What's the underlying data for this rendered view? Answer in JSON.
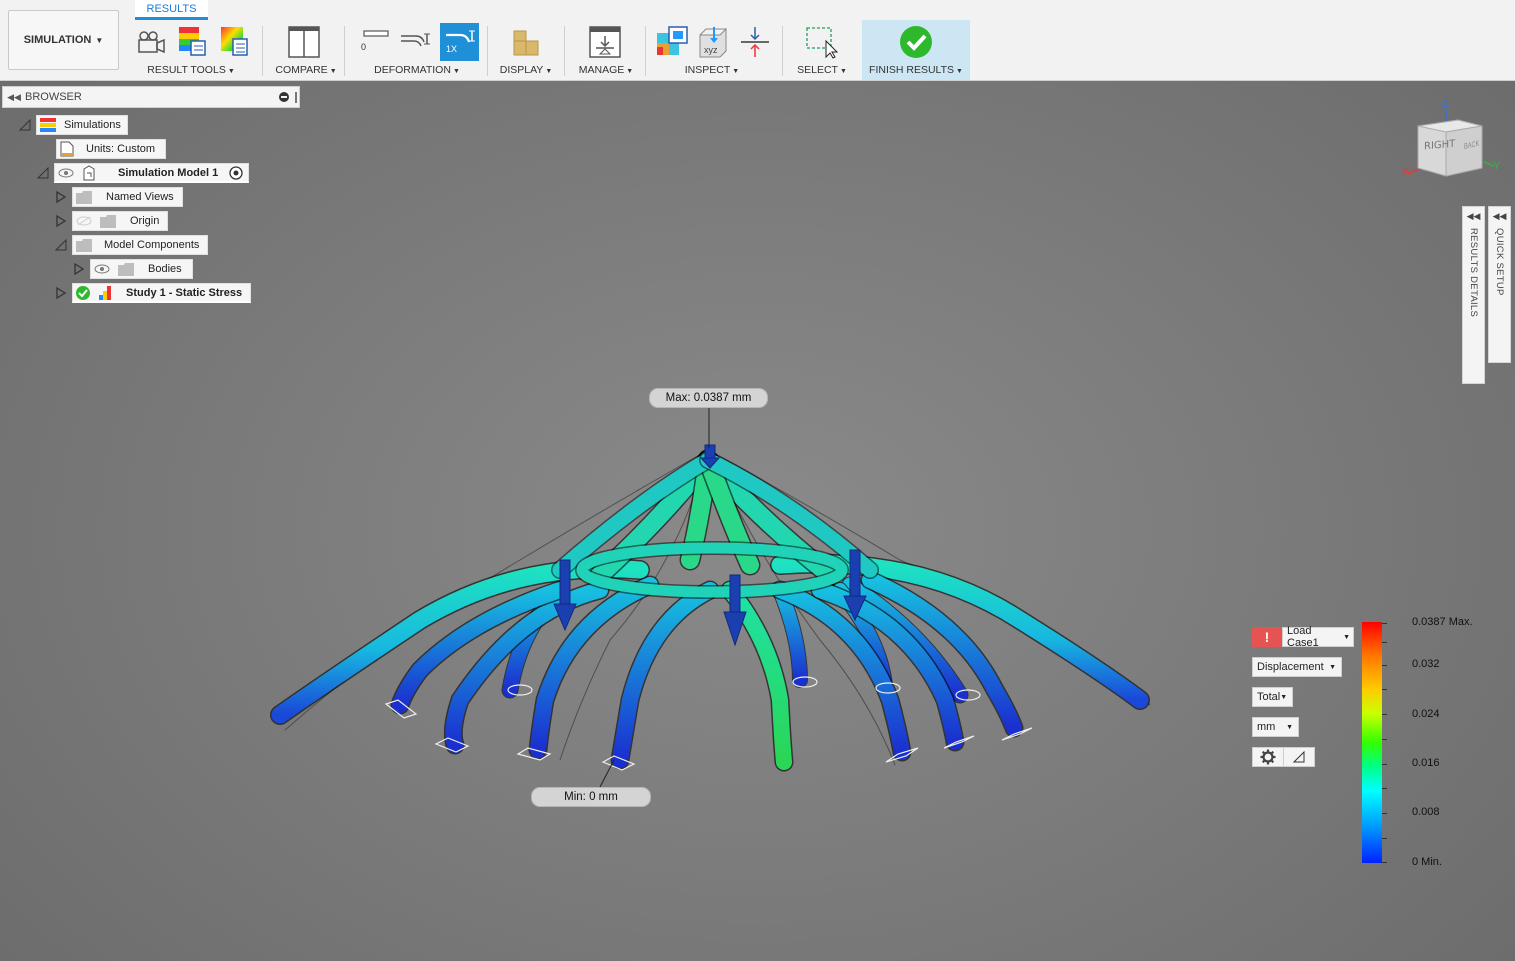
{
  "toolbar": {
    "workspace": "SIMULATION",
    "active_tab": "RESULTS",
    "groups": {
      "result_tools": "RESULT TOOLS",
      "compare": "COMPARE",
      "deformation": "DEFORMATION",
      "display": "DISPLAY",
      "manage": "MANAGE",
      "inspect": "INSPECT",
      "select": "SELECT",
      "finish_results": "FINISH RESULTS"
    },
    "deformation_scale_zero": "0",
    "deformation_scale_active": "1X",
    "inspect_xyz": "xyz"
  },
  "browser": {
    "title": "BROWSER",
    "tree": {
      "simulations": "Simulations",
      "units": "Units: Custom",
      "model": "Simulation Model 1",
      "named_views": "Named Views",
      "origin": "Origin",
      "model_components": "Model Components",
      "bodies": "Bodies",
      "study": "Study 1 - Static Stress"
    }
  },
  "viewport": {
    "max_label": "Max: 0.0387 mm",
    "min_label": "Min: 0 mm"
  },
  "viewcube": {
    "face_right": "RIGHT",
    "face_back": "BACK",
    "axis_z": "Z",
    "axis_x": "X",
    "axis_y": "Y"
  },
  "side_panels": {
    "results_details": "RESULTS DETAILS",
    "quick_setup": "QUICK SETUP"
  },
  "legend": {
    "load_case": "Load Case1",
    "result_type": "Displacement",
    "component": "Total",
    "unit": "mm",
    "ticks": [
      "0.0387 Max.",
      "0.032",
      "0.024",
      "0.016",
      "0.008",
      "0 Min."
    ],
    "warning_symbol": "!",
    "colors": {
      "max": "#ff0000",
      "mid": "#33ff00",
      "min": "#0022ff"
    }
  }
}
